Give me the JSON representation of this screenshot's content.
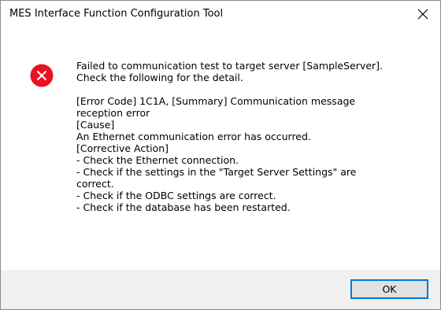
{
  "window": {
    "title": "MES Interface Function Configuration Tool",
    "close_icon": "close-icon"
  },
  "message": {
    "icon": "error-icon",
    "lines": [
      "Failed to communication test to target server [SampleServer].",
      "Check the following for the detail.",
      "",
      "[Error Code] 1C1A, [Summary] Communication message",
      "reception error",
      "[Cause]",
      "An Ethernet communication error has occurred.",
      "[Corrective Action]",
      "- Check the Ethernet connection.",
      "- Check if the settings in the \"Target Server Settings\" are",
      "correct.",
      "- Check if the ODBC settings are correct.",
      "- Check if the database has been restarted."
    ]
  },
  "buttons": {
    "ok_label": "OK"
  },
  "colors": {
    "error_red": "#e81123",
    "accent": "#0078d7",
    "footer_bg": "#f0f0f0"
  }
}
